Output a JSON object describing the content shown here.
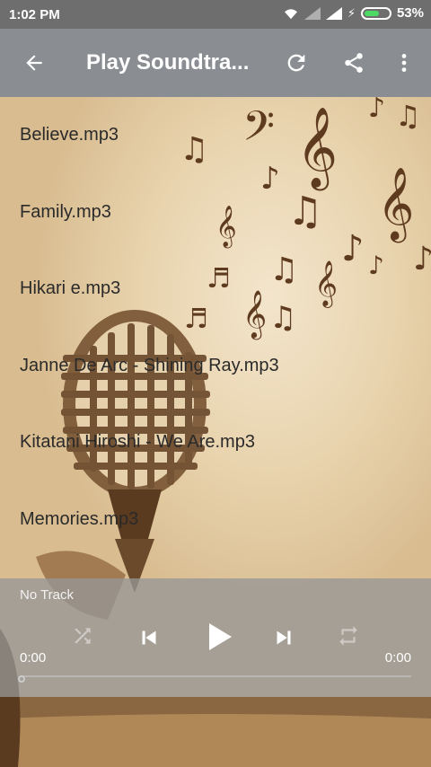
{
  "status_bar": {
    "time": "1:02 PM",
    "battery": "53%"
  },
  "toolbar": {
    "title": "Play Soundtra...",
    "back_icon": "arrow-back-icon",
    "refresh_icon": "refresh-icon",
    "share_icon": "share-icon",
    "more_icon": "more-vert-icon"
  },
  "tracks": [
    "Believe.mp3",
    "Family.mp3",
    "Hikari e.mp3",
    "Janne De Arc - Shining Ray.mp3",
    "Kitatani Hiroshi - We Are.mp3",
    "Memories.mp3"
  ],
  "player": {
    "track_name": "No Track",
    "time_elapsed": "0:00",
    "time_total": "0:00",
    "progress": 0
  }
}
